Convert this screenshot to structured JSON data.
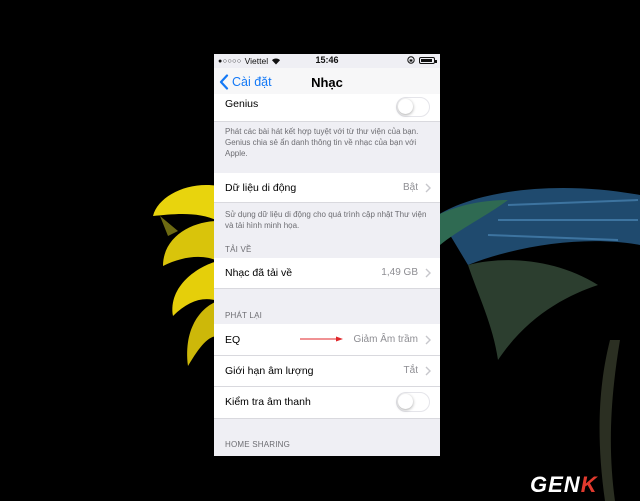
{
  "status_bar": {
    "carrier": "Viettel",
    "time": "15:46"
  },
  "nav": {
    "back_label": "Cài đặt",
    "title": "Nhạc"
  },
  "genius": {
    "label": "Genius",
    "toggle_on": false,
    "footer": "Phát các bài hát kết hợp tuyệt với từ thư viện của bạn. Genius chia sẻ ẩn danh thông tin về nhạc của bạn với Apple."
  },
  "cellular": {
    "label": "Dữ liệu di động",
    "value": "Bật",
    "footer": "Sử dụng dữ liệu di động cho quá trình cập nhật Thư viện và tải hình minh họa."
  },
  "downloads": {
    "header": "TẢI VỀ",
    "label": "Nhạc đã tải về",
    "value": "1,49 GB"
  },
  "playback": {
    "header": "PHÁT LẠI",
    "eq_label": "EQ",
    "eq_value": "Giảm Âm trầm",
    "volume_limit_label": "Giới hạn âm lượng",
    "volume_limit_value": "Tắt",
    "sound_check_label": "Kiểm tra âm thanh",
    "sound_check_on": false
  },
  "home_sharing": {
    "header": "HOME SHARING"
  },
  "watermark": {
    "text_main": "GEN",
    "text_accent": "K"
  },
  "colors": {
    "accent": "#1479f6",
    "annotation_arrow": "#e0262a",
    "watermark_accent": "#e23a2e"
  }
}
